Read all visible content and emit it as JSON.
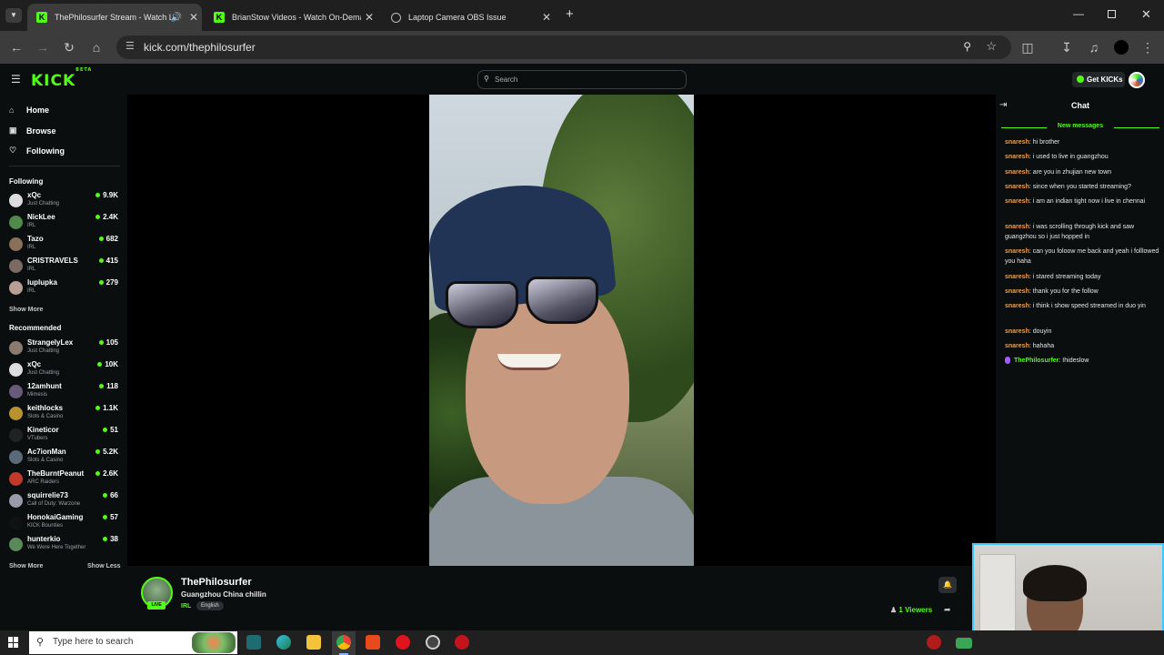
{
  "browser": {
    "tabs": [
      {
        "title": "ThePhilosurfer Stream - Watch Live",
        "active": true,
        "favicon": "kick-icon"
      },
      {
        "title": "BrianStow Videos - Watch On-Demand",
        "active": false,
        "favicon": "kick-icon"
      },
      {
        "title": "Laptop Camera OBS Issue",
        "active": false,
        "favicon": "globe-icon"
      }
    ],
    "url": "kick.com/thephilosurfer"
  },
  "header": {
    "logo": "KICK",
    "logo_tag": "BETA",
    "search_placeholder": "Search",
    "get_kicks": "Get KICKs"
  },
  "sidebar": {
    "nav": [
      {
        "label": "Home",
        "icon": "home-icon"
      },
      {
        "label": "Browse",
        "icon": "browse-icon"
      },
      {
        "label": "Following",
        "icon": "heart-icon"
      }
    ],
    "following_title": "Following",
    "following": [
      {
        "name": "xQc",
        "category": "Just Chatting",
        "viewers": "9.9K",
        "color": "#dddddd"
      },
      {
        "name": "NickLee",
        "category": "IRL",
        "viewers": "2.4K",
        "color": "#4f8a4a"
      },
      {
        "name": "Tazo",
        "category": "IRL",
        "viewers": "682",
        "color": "#8a6f5a"
      },
      {
        "name": "CRISTRAVELS",
        "category": "IRL",
        "viewers": "415",
        "color": "#7a6a63"
      },
      {
        "name": "luplupka",
        "category": "IRL",
        "viewers": "279",
        "color": "#b89f95"
      }
    ],
    "following_more": "Show More",
    "recommended_title": "Recommended",
    "recommended": [
      {
        "name": "StrangelyLex",
        "category": "Just Chatting",
        "viewers": "105",
        "color": "#8a7a70"
      },
      {
        "name": "xQc",
        "category": "Just Chatting",
        "viewers": "10K",
        "color": "#dddddd"
      },
      {
        "name": "12amhunt",
        "category": "Mimesis",
        "viewers": "118",
        "color": "#6a5a7a"
      },
      {
        "name": "keithlocks",
        "category": "Slots & Casino",
        "viewers": "1.1K",
        "color": "#b8922f"
      },
      {
        "name": "Kineticor",
        "category": "VTubers",
        "viewers": "51",
        "color": "#222222"
      },
      {
        "name": "Ac7ionMan",
        "category": "Slots & Casino",
        "viewers": "5.2K",
        "color": "#5a6a7a"
      },
      {
        "name": "TheBurntPeanut",
        "category": "ARC Raiders",
        "viewers": "2.6K",
        "color": "#c0392b"
      },
      {
        "name": "squirrelie73",
        "category": "Call of Duty: Warzone",
        "viewers": "66",
        "color": "#9a9aaa"
      },
      {
        "name": "HonokaiGaming",
        "category": "KICK Bounties",
        "viewers": "57",
        "color": "#111111"
      },
      {
        "name": "hunterkio",
        "category": "We Were Here Together",
        "viewers": "38",
        "color": "#5a8a5a"
      }
    ],
    "show_more": "Show More",
    "show_less": "Show Less"
  },
  "stream": {
    "streamer": "ThePhilosurfer",
    "title": "Guangzhou China chillin",
    "category": "IRL",
    "language": "English",
    "live_badge": "LIVE",
    "viewers_count": "1",
    "viewers_label": "Viewers"
  },
  "chat": {
    "title": "Chat",
    "new_messages": "New messages",
    "messages": [
      {
        "user": "snaresh",
        "text": "hi brother"
      },
      {
        "user": "snaresh",
        "text": "i used to live in guangzhou"
      },
      {
        "user": "snaresh",
        "text": "are you in zhujian new town"
      },
      {
        "user": "snaresh",
        "text": "since when you started streaming?"
      },
      {
        "user": "snaresh",
        "text": "i am an indian tight now i live in chennai"
      },
      {
        "user": "snaresh",
        "text": "i was scrolling through kick and saw guangzhou so i just hopped in"
      },
      {
        "user": "snaresh",
        "text": "can you foloow me back and yeah i folllowed you haha"
      },
      {
        "user": "snaresh",
        "text": "i stared streaming today"
      },
      {
        "user": "snaresh",
        "text": "thank you for the follow"
      },
      {
        "user": "snaresh",
        "text": "i think i show speed streamed in duo yin"
      },
      {
        "user": "snaresh",
        "text": "douyin"
      },
      {
        "user": "snaresh",
        "text": "hahaha"
      },
      {
        "user": "ThePhilosurfer",
        "text": "Ihideslow"
      }
    ]
  },
  "taskbar": {
    "search_placeholder": "Type here to search"
  }
}
